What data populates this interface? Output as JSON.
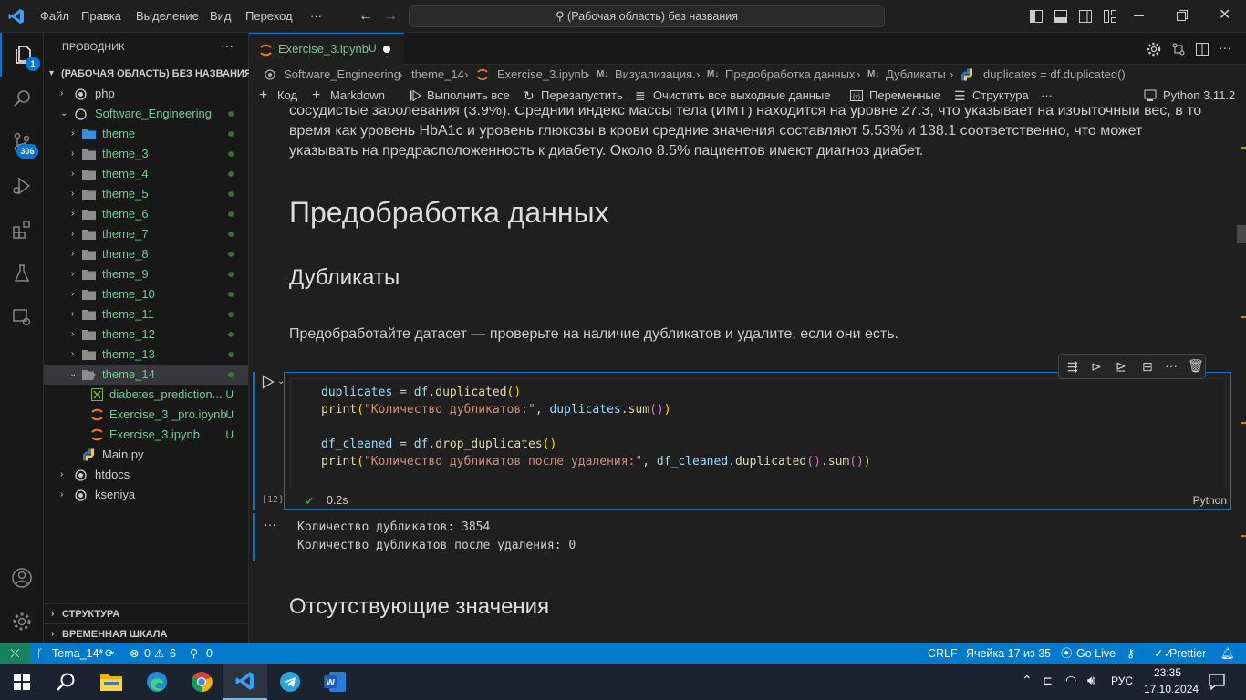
{
  "titlebar": {
    "menu": [
      "Файл",
      "Правка",
      "Выделение",
      "Вид",
      "Переход",
      "···"
    ],
    "search": "(Рабочая область) без названия"
  },
  "activity": {
    "explorer_badge": "1",
    "scm_badge": "306"
  },
  "sidebar": {
    "title": "ПРОВОДНИК",
    "more": "···",
    "workspace": "(РАБОЧАЯ ОБЛАСТЬ) БЕЗ НАЗВАНИЯ",
    "items": [
      {
        "label": "php"
      },
      {
        "label": "Software_Engineering"
      },
      {
        "label": "theme"
      },
      {
        "label": "theme_3"
      },
      {
        "label": "theme_4"
      },
      {
        "label": "theme_5"
      },
      {
        "label": "theme_6"
      },
      {
        "label": "theme_7"
      },
      {
        "label": "theme_8"
      },
      {
        "label": "theme_9"
      },
      {
        "label": "theme_10"
      },
      {
        "label": "theme_11"
      },
      {
        "label": "theme_12"
      },
      {
        "label": "theme_13"
      },
      {
        "label": "theme_14"
      },
      {
        "label": "diabetes_prediction...",
        "status": "U"
      },
      {
        "label": "Exercise_3 _pro.ipynb",
        "status": "U"
      },
      {
        "label": "Exercise_3.ipynb",
        "status": "U"
      },
      {
        "label": "Main.py"
      },
      {
        "label": "htdocs"
      },
      {
        "label": "kseniya"
      }
    ],
    "outline": "СТРУКТУРА",
    "timeline": "ВРЕМЕННАЯ ШКАЛА"
  },
  "tab": {
    "label": "Exercise_3.ipynb",
    "status": "U"
  },
  "breadcrumb": [
    "Software_Engineering",
    "theme_14",
    "Exercise_3.ipynb",
    "Визуализация.",
    "Предобработка данных",
    "Дубликаты",
    "duplicates = df.duplicated()"
  ],
  "toolbar": {
    "code": "Код",
    "markdown": "Markdown",
    "run_all": "Выполнить все",
    "restart": "Перезапустить",
    "clear": "Очистить все выходные данные",
    "variables": "Переменные",
    "outline": "Структура",
    "more": "···",
    "kernel": "Python 3.11.2"
  },
  "notebook": {
    "para1": "сосудистые заболевания (3.9%). Средний индекс массы тела (ИМТ) находится на уровне 27.3, что указывает на избыточный вес, в то",
    "para2": "время как уровень HbA1c и уровень глюкозы в крови средние значения составляют 5.53% и 138.1 соответственно, что может",
    "para3": "указывать на предрасположенность к диабету. Около 8.5% пациентов имеют диагноз диабет.",
    "h1": "Предобработка данных",
    "h2": "Дубликаты",
    "task": "Предобработайте датасет — проверьте на наличие дубликатов и удалите, если они есть.",
    "exec_count": "[12]",
    "exec_time": "0.2s",
    "lang": "Python",
    "output1": "Количество дубликатов: 3854",
    "output2": "Количество дубликатов после удаления: 0",
    "output_more": "···",
    "h2b": "Отсутствующие значения"
  },
  "statusbar": {
    "branch": "Tema_14*",
    "errors": "0",
    "warnings": "6",
    "ports": "0",
    "eol": "CRLF",
    "cell": "Ячейка 17 из 35",
    "golive": "Go Live",
    "prettier": "Prettier"
  },
  "taskbar": {
    "lang": "РУС",
    "time": "23:35",
    "date": "17.10.2024"
  }
}
